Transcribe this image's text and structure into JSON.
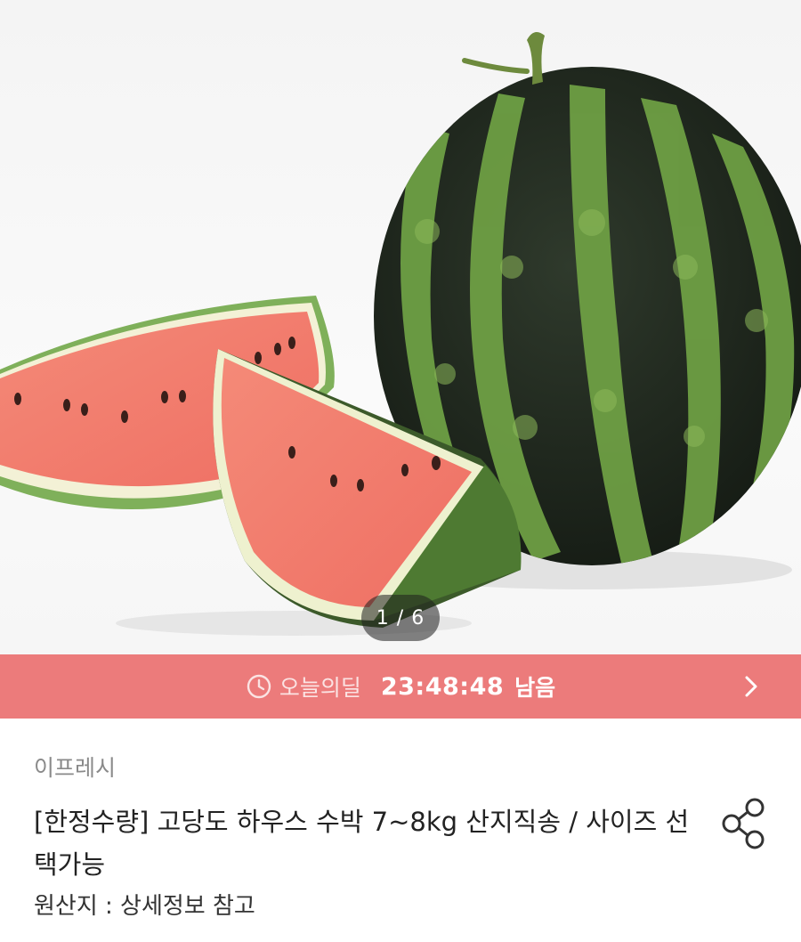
{
  "gallery": {
    "counter": "1 / 6",
    "image_alt": "watermelon product photo"
  },
  "deal": {
    "icon": "clock-icon",
    "label": "오늘의딜",
    "time": "23:48:48",
    "suffix": "남음",
    "arrow_icon": "chevron-right-icon",
    "color": "#ec7b7b"
  },
  "product": {
    "brand": "이프레시",
    "title": "[한정수량] 고당도 하우스 수박 7~8kg 산지직송 / 사이즈 선택가능",
    "origin": "원산지 : 상세정보 참고",
    "share_icon": "share-icon"
  }
}
